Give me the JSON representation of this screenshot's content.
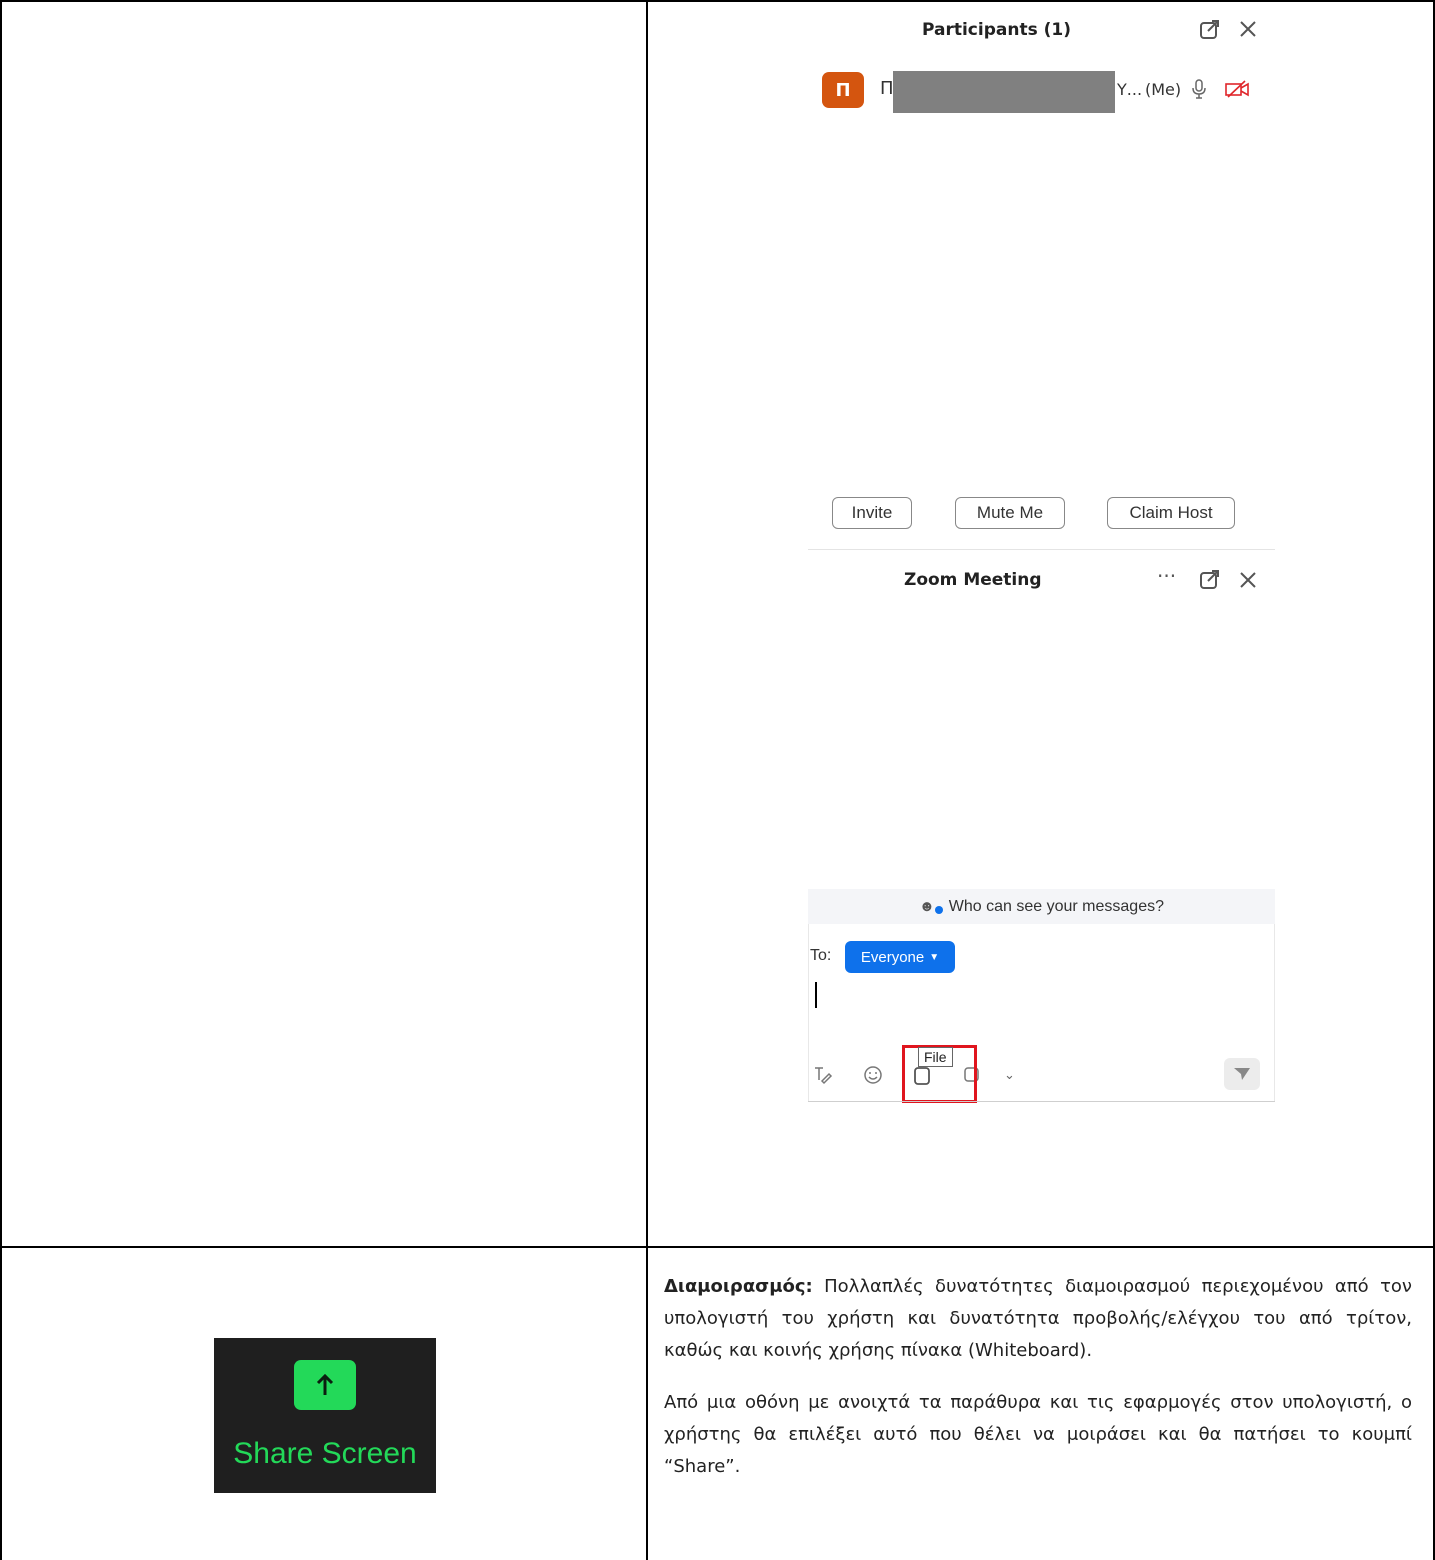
{
  "participants_panel": {
    "title": "Participants (1)",
    "participant": {
      "avatar_letter": "Π",
      "name_visible_start": "Π",
      "name_visible_end": "Υ...",
      "me_tag": "(Me)"
    },
    "buttons": {
      "invite": "Invite",
      "mute_me": "Mute Me",
      "claim_host": "Claim Host"
    }
  },
  "chat_panel": {
    "title": "Zoom Meeting",
    "who_can_see": "Who can see your messages?",
    "to_label": "To:",
    "recipient": "Everyone",
    "tooltip": "File"
  },
  "share": {
    "label": "Share Screen"
  },
  "description": {
    "heading": "Διαμοιρασμός:",
    "paragraph1": "Πολλαπλές δυνατότητες διαμοιρασμού περιεχομένου από τον υπολογιστή του χρήστη και δυνατότητα προβολής/ελέγχου του από τρίτον, καθώς και κοινής χρήσης πίνακα (Whiteboard).",
    "paragraph2": "Από μια οθόνη με ανοιχτά τα παράθυρα και τις εφαρμογές στον υπολογιστή, ο χρήστης θα επιλέξει αυτό που θέλει να μοιράσει και θα πατήσει το κουμπί “Share”."
  },
  "colors": {
    "avatar": "#d4550f",
    "zoom_blue": "#0e71eb",
    "share_green": "#23d959",
    "highlight_red": "#e0151e"
  }
}
